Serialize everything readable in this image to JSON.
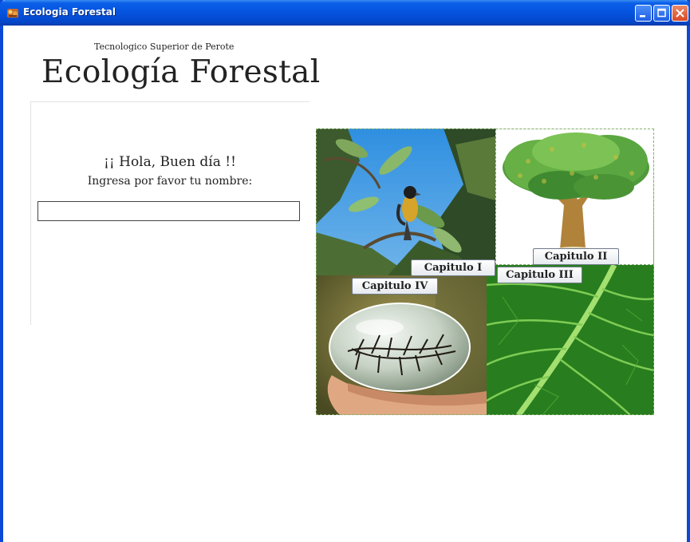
{
  "window": {
    "title": "Ecologia Forestal",
    "controls": [
      "minimize",
      "maximize",
      "close"
    ]
  },
  "header": {
    "subtitle": "Tecnologico Superior de Perote",
    "title": "Ecología Forestal"
  },
  "form": {
    "greeting": "¡¡ Hola, Buen día !!",
    "prompt": "Ingresa por favor tu nombre:",
    "name_value": ""
  },
  "chapters": [
    {
      "label": "Capitulo I",
      "image": "bird-on-branch"
    },
    {
      "label": "Capitulo II",
      "image": "tree"
    },
    {
      "label": "Capitulo III",
      "image": "green-leaf"
    },
    {
      "label": "Capitulo IV",
      "image": "hand-holding-water-sphere"
    }
  ],
  "colors": {
    "titlebar": "#0553df",
    "frame": "#0a48d8",
    "close_button": "#d84a24"
  }
}
